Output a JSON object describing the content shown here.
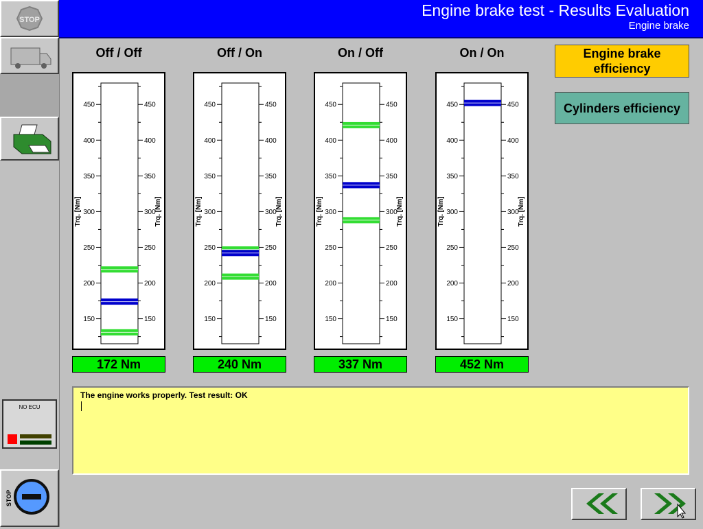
{
  "header": {
    "title": "Engine brake test - Results Evaluation",
    "subtitle": "Engine brake"
  },
  "sidebar": {
    "stop_label": "STOP",
    "ecu_label": "NO ECU",
    "stop_knob_label": "STOP"
  },
  "chart_data": {
    "type": "bar",
    "ylabel": "Trq. [Nm]",
    "ylim": [
      115,
      480
    ],
    "yticks": [
      150,
      200,
      250,
      300,
      350,
      400,
      450
    ],
    "colors": {
      "limit": "#33dd33",
      "measured": "#0000cc"
    },
    "gauges": [
      {
        "name": "Off / Off",
        "value_label": "172 Nm",
        "measured": 174,
        "lower_limit": 131,
        "upper_limit": 219
      },
      {
        "name": "Off / On",
        "value_label": "240 Nm",
        "measured": 242,
        "lower_limit": 209,
        "upper_limit": 247
      },
      {
        "name": "On / Off",
        "value_label": "337 Nm",
        "measured": 337,
        "lower_limit": 288,
        "upper_limit": 421
      },
      {
        "name": "On / On",
        "value_label": "452 Nm",
        "measured": 452,
        "lower_limit": null,
        "upper_limit": null
      }
    ]
  },
  "buttons": {
    "engine_brake": "Engine brake efficiency",
    "cylinders": "Cylinders efficiency"
  },
  "message": {
    "text": "The engine works properly. Test result: OK"
  },
  "nav": {
    "back": "previous-icon",
    "forward": "next-icon"
  }
}
